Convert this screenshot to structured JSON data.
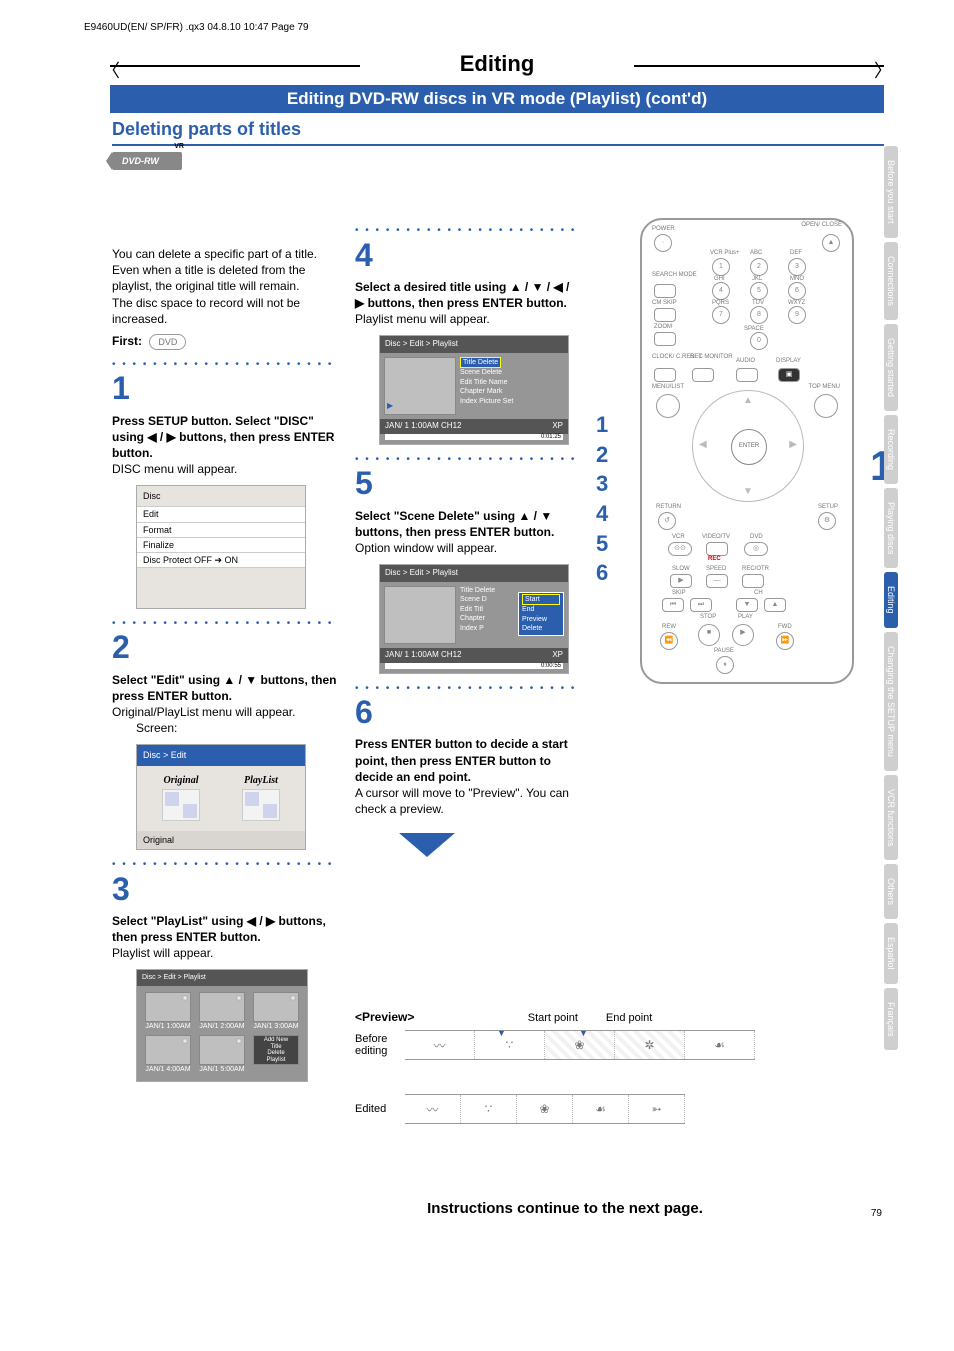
{
  "header": "E9460UD(EN/ SP/FR) .qx3  04.8.10  10:47  Page 79",
  "title": "Editing",
  "blue_bar": "Editing DVD-RW discs in VR mode (Playlist) (cont'd)",
  "section": "Deleting parts of titles",
  "badge": {
    "label": "DVD-RW",
    "vr": "VR"
  },
  "intro": {
    "p1": "You can delete a specific part of a title.",
    "p2": "Even when a title is deleted from the playlist, the original title will remain.",
    "p3": "The disc space to record will not be increased.",
    "first_label": "First:",
    "first_icon": "DVD"
  },
  "steps": {
    "s1": {
      "num": "1",
      "bold": "Press SETUP button. Select \"DISC\" using ◀ / ▶ buttons, then press ENTER button.",
      "sub": "DISC menu will appear."
    },
    "s2": {
      "num": "2",
      "bold": "Select \"Edit\" using ▲ / ▼ buttons, then press ENTER button.",
      "sub": "Original/PlayList menu will appear.",
      "screen": "Screen:"
    },
    "s3": {
      "num": "3",
      "bold": "Select \"PlayList\" using ◀ / ▶ buttons, then press ENTER button.",
      "sub": "Playlist will appear."
    },
    "s4": {
      "num": "4",
      "bold": "Select a desired title using ▲ / ▼ / ◀ / ▶ buttons, then press ENTER button.",
      "sub": "Playlist menu will appear."
    },
    "s5": {
      "num": "5",
      "bold": "Select \"Scene Delete\" using ▲ / ▼ buttons, then press ENTER button.",
      "sub": "Option window will appear."
    },
    "s6": {
      "num": "6",
      "bold": "Press ENTER button to decide a start point, then press ENTER button to decide an end point.",
      "sub": "A cursor will move to \"Preview\". You can check a preview."
    }
  },
  "disc_menu": {
    "title": "Disc",
    "items": [
      "Edit",
      "Format",
      "Finalize",
      "Disc Protect OFF ➔ ON"
    ]
  },
  "edit_menu": {
    "crumb": "Disc > Edit",
    "tiles": [
      "Original",
      "PlayList"
    ],
    "footer": "Original"
  },
  "playlist_grid": {
    "crumb": "Disc > Edit > Playlist",
    "cells": [
      "JAN/1  1:00AM",
      "JAN/1  2:00AM",
      "JAN/1  3:00AM",
      "JAN/1  4:00AM",
      "JAN/1  5:00AM"
    ],
    "new": [
      "Add New",
      "Title",
      "Delete",
      "Playlist"
    ]
  },
  "osd4": {
    "crumb": "Disc > Edit > Playlist",
    "items": [
      "Title Delete",
      "Scene Delete",
      "Edit Title Name",
      "Chapter Mark",
      "Index Picture Set"
    ],
    "ft_l": "JAN/ 1  1:00AM  CH12",
    "ft_r": "XP",
    "time": "0:01:25"
  },
  "osd5": {
    "crumb": "Disc > Edit > Playlist",
    "items": [
      "Title Delete",
      "Scene D",
      "Edit Titl",
      "Chapter",
      "Index P"
    ],
    "popup": [
      "Start",
      "End",
      "Preview",
      "Delete"
    ],
    "ft_l": "JAN/ 1  1:00AM  CH12",
    "ft_r": "XP",
    "time": "0:00:55"
  },
  "remote_nums": [
    "1",
    "2",
    "3",
    "4",
    "5",
    "6"
  ],
  "big_one": "1",
  "side_tabs": [
    {
      "label": "Before you start",
      "cls": "grey"
    },
    {
      "label": "Connections",
      "cls": "grey"
    },
    {
      "label": "Getting started",
      "cls": "grey"
    },
    {
      "label": "Recording",
      "cls": "grey"
    },
    {
      "label": "Playing discs",
      "cls": "grey"
    },
    {
      "label": "Editing",
      "cls": "blue"
    },
    {
      "label": "Changing the SETUP menu",
      "cls": "grey"
    },
    {
      "label": "VCR functions",
      "cls": "grey"
    },
    {
      "label": "Others",
      "cls": "grey"
    },
    {
      "label": "Español",
      "cls": "grey"
    },
    {
      "label": "Français",
      "cls": "grey"
    }
  ],
  "preview": {
    "header": "<Preview>",
    "labels": [
      "Start point",
      "End point"
    ],
    "before": "Before editing",
    "edited": "Edited",
    "glyphs_before": [
      "〰",
      "∵",
      "❀",
      "✲",
      "☙"
    ],
    "glyphs_edited": [
      "〰",
      "∵",
      "❀",
      "☙",
      "➳"
    ]
  },
  "cont": "Instructions continue to the next page.",
  "page_num": "79",
  "remote": {
    "top_labels": {
      "power": "POWER",
      "open": "OPEN/\nCLOSE",
      "vcsplus": "VCR Plus+",
      "abc": "ABC",
      "def": "DEF",
      "search": "SEARCH\nMODE",
      "ghi": "GHI",
      "jkl": "JKL",
      "mno": "MNO",
      "cmskip": "CM SKIP",
      "pqrs": "PQRS",
      "tuv": "TUV",
      "wxyz": "WXYZ",
      "zoom": "ZOOM",
      "space": "SPACE"
    },
    "mid_labels": {
      "c_reset": "CLOCK/\nC.RESET",
      "rec_monitor": "REC\nMONITOR",
      "audio": "AUDIO",
      "display": "DISPLAY",
      "menulist": "MENU/LIST",
      "topmenu": "TOP MENU",
      "enter": "ENTER",
      "return": "RETURN",
      "setup": "SETUP"
    },
    "low_labels": {
      "vcr": "VCR",
      "videotv": "VIDEO/TV",
      "dvd": "DVD",
      "rec": "REC",
      "slow": "SLOW",
      "speed": "SPEED",
      "recotr": "REC/OTR",
      "skip": "SKIP",
      "ch": "CH",
      "stop": "STOP",
      "play": "PLAY",
      "rew": "REW",
      "fwd": "FWD",
      "pause": "PAUSE"
    },
    "keypad": [
      "1",
      "2",
      "3",
      "4",
      "5",
      "6",
      "7",
      "8",
      "9",
      "0"
    ]
  }
}
